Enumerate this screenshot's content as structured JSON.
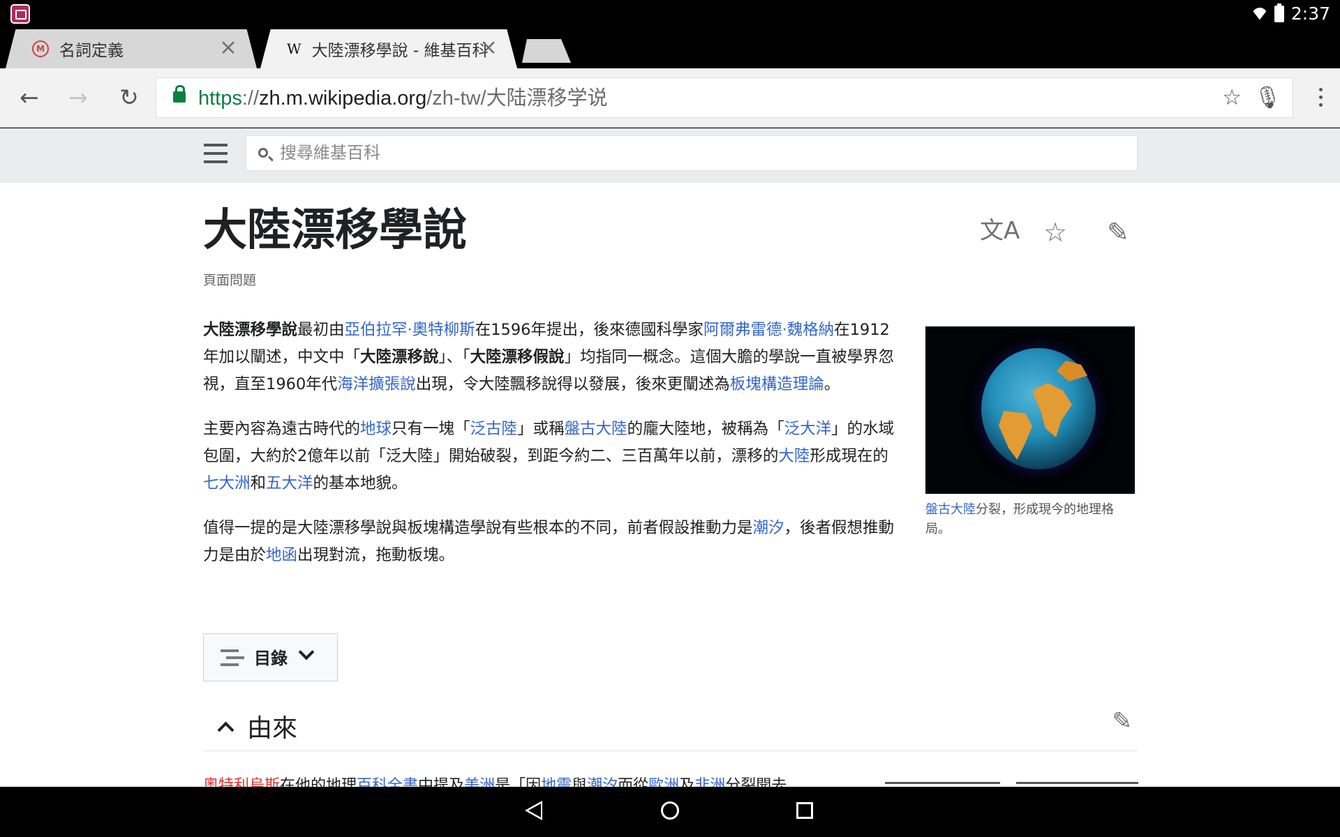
{
  "status": {
    "time": "2:37",
    "icons": [
      "app-icon",
      "wifi-icon",
      "battery-icon"
    ]
  },
  "tabs": [
    {
      "title": "名詞定義",
      "favicon": "mab-favicon-icon",
      "active": false
    },
    {
      "title": "大陸漂移學說 - 維基百科",
      "favicon": "wikipedia-favicon-icon",
      "active": true
    }
  ],
  "address": {
    "protocol": "https",
    "separator": "://",
    "domain": "zh.m.wikipedia.org",
    "path": "/zh-tw/大陆漂移学说"
  },
  "search": {
    "placeholder": "搜尋維基百科"
  },
  "article": {
    "title": "大陸漂移學說",
    "subtitle": "頁面問題",
    "paragraphs": [
      [
        {
          "text": "大陸漂移學說",
          "style": "bold"
        },
        {
          "text": "最初由"
        },
        {
          "text": "亞伯拉罕·奧特柳斯",
          "link": true
        },
        {
          "text": "在1596年提出，後來德國科學家"
        },
        {
          "text": "阿爾弗雷德·魏格納",
          "link": true
        },
        {
          "text": "在1912年加以闡述，中文中「"
        },
        {
          "text": "大陸漂移說",
          "style": "bold"
        },
        {
          "text": "」、「"
        },
        {
          "text": "大陸漂移假說",
          "style": "bold"
        },
        {
          "text": "」均指同一概念。這個大膽的學說一直被學界忽視，直至1960年代"
        },
        {
          "text": "海洋擴張說",
          "link": true
        },
        {
          "text": "出現，令大陸飄移說得以發展，後來更闡述為"
        },
        {
          "text": "板塊構造理論",
          "link": true
        },
        {
          "text": "。"
        }
      ],
      [
        {
          "text": "主要內容為遠古時代的"
        },
        {
          "text": "地球",
          "link": true
        },
        {
          "text": "只有一塊「"
        },
        {
          "text": "泛古陸",
          "link": true
        },
        {
          "text": "」或稱"
        },
        {
          "text": "盤古大陸",
          "link": true
        },
        {
          "text": "的龐大陸地，被稱為「"
        },
        {
          "text": "泛大洋",
          "link": true
        },
        {
          "text": "」的水域包圍，大約於2億年以前「泛大陸」開始破裂，到距今約二、三百萬年以前，漂移的"
        },
        {
          "text": "大陸",
          "link": true
        },
        {
          "text": "形成現在的"
        },
        {
          "text": "七大洲",
          "link": true
        },
        {
          "text": "和"
        },
        {
          "text": "五大洋",
          "link": true
        },
        {
          "text": "的基本地貌。"
        }
      ],
      [
        {
          "text": "值得一提的是大陸漂移學說與板塊構造學說有些根本的不同，前者假設推動力是"
        },
        {
          "text": "潮汐",
          "link": true
        },
        {
          "text": "，後者假想推動力是由於"
        },
        {
          "text": "地函",
          "link": true
        },
        {
          "text": "出現對流，拖動板塊。"
        }
      ]
    ],
    "caption": [
      {
        "text": "盤古大陸",
        "link": true
      },
      {
        "text": "分裂，形成現今的地理格局。"
      }
    ],
    "toc": "目錄",
    "section": "由來",
    "cut_text": [
      {
        "text": "奧特利烏斯",
        "link": true,
        "red": true
      },
      {
        "text": "在他的地理"
      },
      {
        "text": "百科全書",
        "link": true
      },
      {
        "text": "中提及"
      },
      {
        "text": "美洲",
        "link": true
      },
      {
        "text": "是「因"
      },
      {
        "text": "地震",
        "link": true
      },
      {
        "text": "與"
      },
      {
        "text": "潮汐",
        "link": true
      },
      {
        "text": "而從"
      },
      {
        "text": "歐洲",
        "link": true
      },
      {
        "text": "及"
      },
      {
        "text": "非洲",
        "link": true
      },
      {
        "text": "分裂開去"
      }
    ]
  },
  "colors": {
    "link": "#3366cc",
    "secure": "#0b8043",
    "wiki_header": "#eaecf0"
  }
}
